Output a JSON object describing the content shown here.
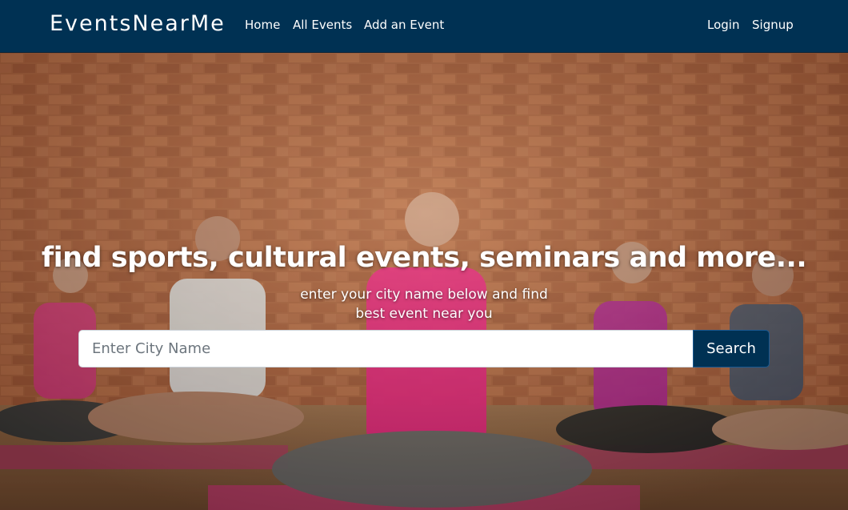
{
  "navbar": {
    "brand": "EventsNearMe",
    "links": {
      "home": "Home",
      "all_events": "All Events",
      "add_event": "Add an Event",
      "login": "Login",
      "signup": "Signup"
    },
    "background_color": "#003153"
  },
  "hero": {
    "headline": "find sports, cultural events, seminars and more...",
    "subline_1": "enter your city name below and find",
    "subline_2": "best event near you",
    "search": {
      "placeholder": "Enter City Name",
      "value": "",
      "button_label": "Search"
    }
  }
}
